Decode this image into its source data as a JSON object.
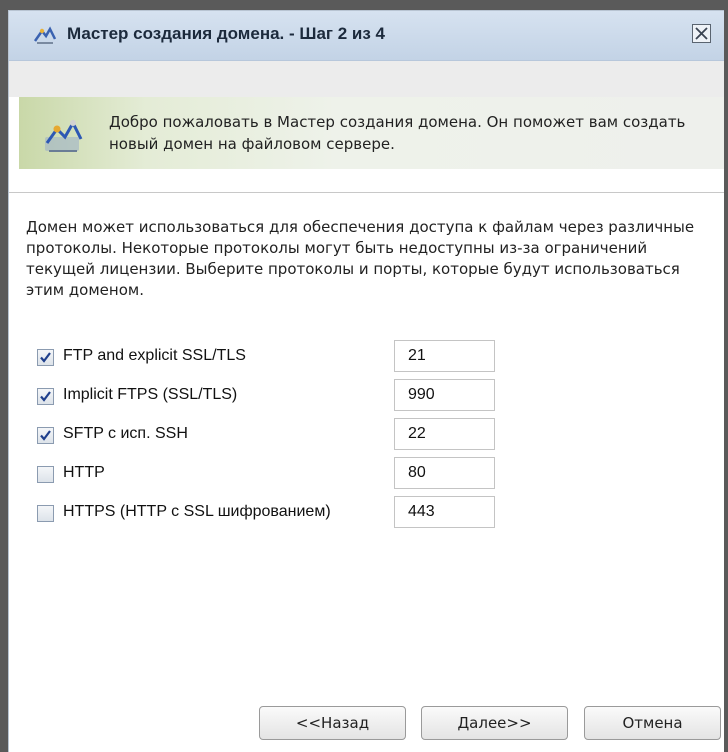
{
  "window": {
    "title": "Мастер создания домена. - Шаг 2 из 4"
  },
  "banner": {
    "text": "Добро пожаловать в Мастер создания домена. Он поможет вам создать новый домен на файловом сервере."
  },
  "description": "Домен может использоваться для обеспечения доступа к файлам через различные протоколы. Некоторые протоколы могут быть недоступны из-за ограничений текущей лицензии. Выберите протоколы и порты, которые будут использоваться этим доменом.",
  "protocols": [
    {
      "label": "FTP and explicit SSL/TLS",
      "checked": true,
      "port": "21"
    },
    {
      "label": "Implicit FTPS (SSL/TLS)",
      "checked": true,
      "port": "990"
    },
    {
      "label": "SFTP с исп. SSH",
      "checked": true,
      "port": "22"
    },
    {
      "label": "HTTP",
      "checked": false,
      "port": "80"
    },
    {
      "label": "HTTPS (HTTP с SSL шифрованием)",
      "checked": false,
      "port": "443"
    }
  ],
  "buttons": {
    "back": "<<Назад",
    "next": "Далее>>",
    "cancel": "Отмена"
  },
  "icons": {
    "title": "wizard-icon",
    "banner": "wizard-icon",
    "close": "close-icon",
    "check": "checkmark-icon"
  },
  "colors": {
    "titlebar": "#c9d8ea",
    "banner_accent": "#c9d8a8",
    "checkmark": "#1f3f8c"
  }
}
